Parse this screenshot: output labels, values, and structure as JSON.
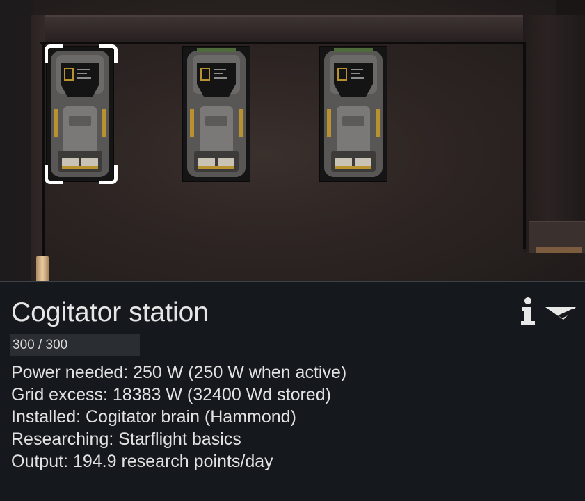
{
  "selection": {
    "title": "Cogitator station",
    "hit_points": {
      "current": 300,
      "max": 300,
      "label": "300 / 300"
    },
    "details": [
      "Power needed: 250 W (250 W when active)",
      "Grid excess: 18383 W (32400 Wd stored)",
      "Installed: Cogitator brain (Hammond)",
      "Researching: Starflight basics",
      "Output: 194.9 research points/day"
    ]
  },
  "icons": {
    "info": "info-icon",
    "collapse": "collapse-chevron-icon",
    "station": "cogitator-station-icon",
    "selection": "selection-bracket-icon"
  },
  "colors": {
    "panel_background": "#15181c",
    "title_text": "#e6e6e6",
    "selection_bracket": "#ffffff",
    "station_accent": "#b8922e"
  }
}
